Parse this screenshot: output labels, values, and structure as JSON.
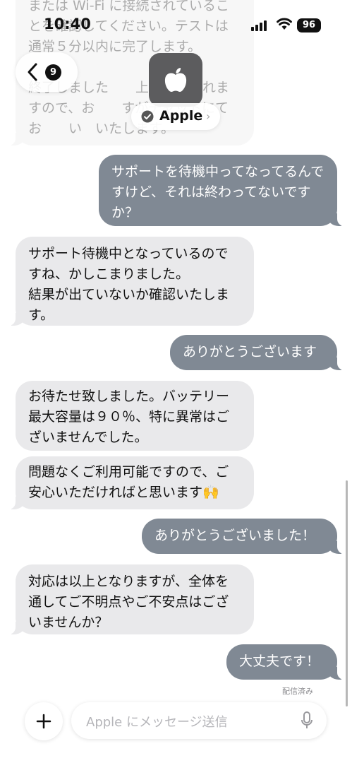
{
  "status_bar": {
    "time": "10:40",
    "battery": "96"
  },
  "header": {
    "back_count": "9",
    "contact_name": "Apple"
  },
  "messages": [
    {
      "from": "apple",
      "text": "または Wi-Fi に接続されていることを確認してください。テストは通常５分以内に完了します。\n\n終了しました　　上に表示されますので、お　　すがチャットにてお　　い　いたします。"
    },
    {
      "from": "user",
      "text": "サポートを待機中ってなってるんですけど、それは終わってないですか？"
    },
    {
      "from": "apple",
      "text": "サポート待機中となっているのですね、かしこまりました。\n結果が出ていないか確認いたします。"
    },
    {
      "from": "user",
      "text": "ありがとうございます"
    },
    {
      "from": "apple",
      "text": "お待たせ致しました。バッテリー最大容量は９０％、特に異常はございませんでした。"
    },
    {
      "from": "apple",
      "text": "問題なくご利用可能ですので、ご安心いただければと思います🙌"
    },
    {
      "from": "user",
      "text": "ありがとうございました！"
    },
    {
      "from": "apple",
      "text": "対応は以上となりますが、全体を通してご不明点やご不安点はございませんか？"
    },
    {
      "from": "user",
      "text": "大丈夫です！"
    }
  ],
  "delivery_status": "配信済み",
  "composer": {
    "placeholder": "Apple にメッセージ送信"
  },
  "colors": {
    "incoming_bubble": "#e9e9eb",
    "outgoing_bubble": "#808994",
    "avatar": "#5c5c5e"
  }
}
